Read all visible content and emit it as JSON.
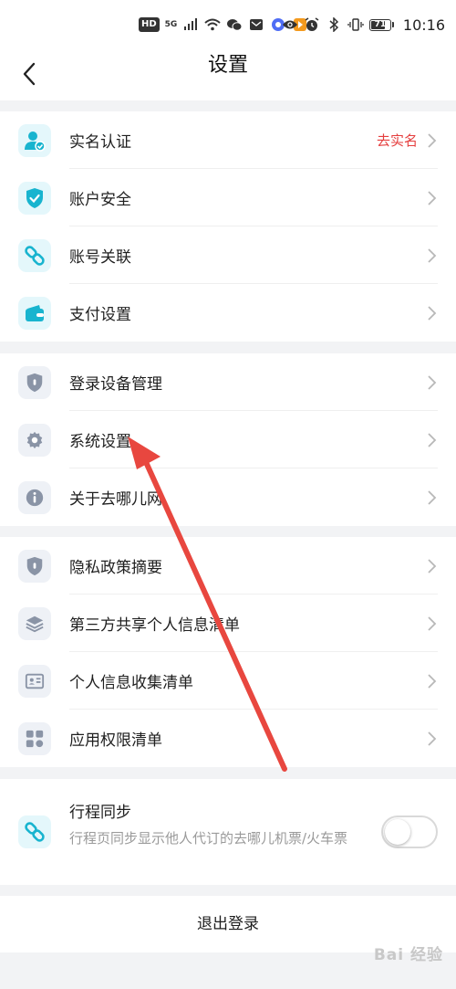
{
  "status_bar": {
    "hd_label": "HD",
    "net_label": "5G",
    "battery": "71",
    "time": "10:16"
  },
  "nav": {
    "title": "设置"
  },
  "groups": {
    "account": [
      {
        "label": "实名认证",
        "extra": "去实名",
        "icon": "id-user-check-icon"
      },
      {
        "label": "账户安全",
        "icon": "shield-check-icon"
      },
      {
        "label": "账号关联",
        "icon": "link-icon"
      },
      {
        "label": "支付设置",
        "icon": "wallet-icon"
      }
    ],
    "device": [
      {
        "label": "登录设备管理",
        "icon": "shield-icon"
      },
      {
        "label": "系统设置",
        "icon": "gear-icon"
      },
      {
        "label": "关于去哪儿网",
        "icon": "info-icon"
      }
    ],
    "privacy": [
      {
        "label": "隐私政策摘要",
        "icon": "shield-icon"
      },
      {
        "label": "第三方共享个人信息清单",
        "icon": "layers-icon"
      },
      {
        "label": "个人信息收集清单",
        "icon": "id-card-icon"
      },
      {
        "label": "应用权限清单",
        "icon": "grid-icon"
      }
    ]
  },
  "trip_sync": {
    "title": "行程同步",
    "description": "行程页同步显示他人代订的去哪儿机票/火车票",
    "enabled": false
  },
  "logout_label": "退出登录",
  "watermark": "Bai 经验",
  "colors": {
    "accent_cyan": "#18b4cf",
    "icon_gray": "#8a94a6",
    "alert_red": "#e53e3e",
    "annotation_arrow": "#e8473f"
  }
}
